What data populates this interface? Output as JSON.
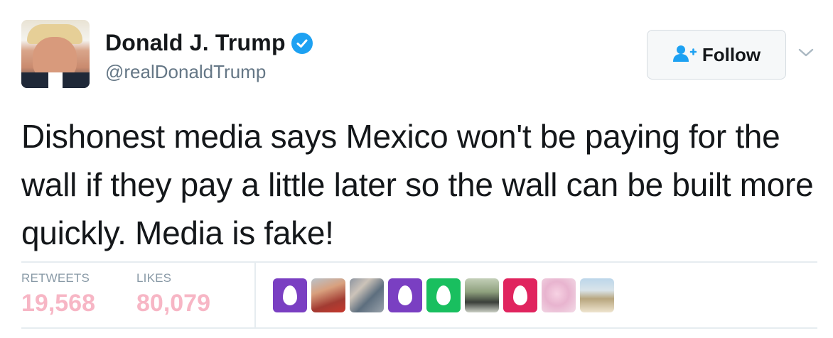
{
  "user": {
    "name": "Donald J. Trump",
    "handle": "@realDonaldTrump",
    "verified": true
  },
  "actions": {
    "follow_label": "Follow"
  },
  "tweet": {
    "text": "Dishonest media says Mexico won't be paying for the wall if they pay a little later so the wall can be built more quickly. Media is fake!"
  },
  "stats": {
    "retweets_label": "RETWEETS",
    "retweets_value": "19,568",
    "likes_label": "LIKES",
    "likes_value": "80,079"
  },
  "likers": [
    {
      "type": "egg",
      "color": "#7a3fc2"
    },
    {
      "type": "photo",
      "icon": "child-photo"
    },
    {
      "type": "photo",
      "icon": "crowd-photo"
    },
    {
      "type": "egg",
      "color": "#7a3fc2"
    },
    {
      "type": "egg",
      "color": "#19bf5f"
    },
    {
      "type": "photo",
      "icon": "outdoor-photo"
    },
    {
      "type": "egg",
      "color": "#e0245e"
    },
    {
      "type": "photo",
      "icon": "flower-photo"
    },
    {
      "type": "photo",
      "icon": "beach-photo"
    }
  ],
  "colors": {
    "accent": "#1da1f2",
    "stat_value": "#f7b6c5",
    "muted": "#657786"
  }
}
